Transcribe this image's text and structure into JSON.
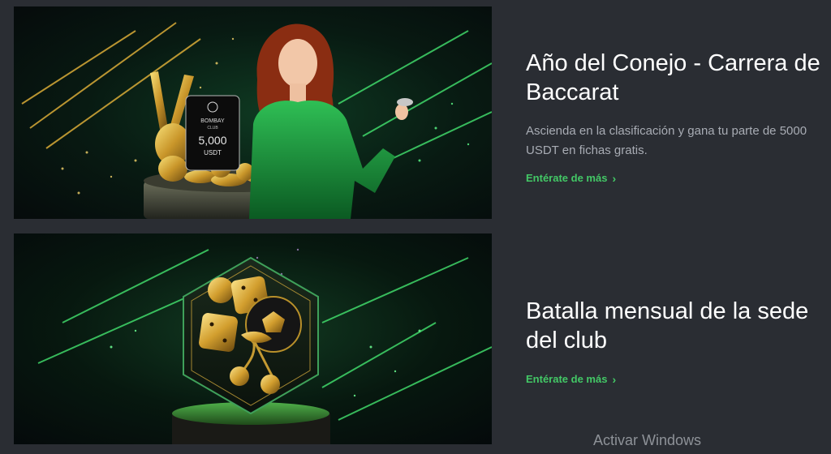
{
  "promos": [
    {
      "title": "Año del Conejo - Carrera de Baccarat",
      "description": "Ascienda en la clasificación y gana tu parte de 5000 USDT en fichas gratis.",
      "link_label": "Entérate de más",
      "chip_brand": "BOMBAY",
      "chip_sub": "CLUB",
      "chip_amount": "5,000",
      "chip_currency": "USDT"
    },
    {
      "title": "Batalla mensual de la sede del club",
      "link_label": "Entérate de más"
    }
  ],
  "icons": {
    "link_chevron": "chevron-right-icon"
  },
  "colors": {
    "background": "#2a2d33",
    "title": "#ffffff",
    "description": "#a8acb4",
    "link": "#43c866"
  },
  "watermark": "Activar Windows"
}
